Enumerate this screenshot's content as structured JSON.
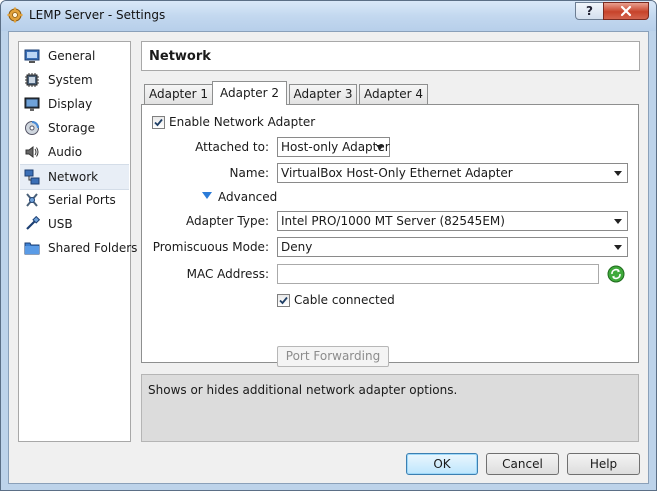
{
  "window": {
    "title": "LEMP Server - Settings",
    "help_label": "?"
  },
  "sidebar": {
    "items": [
      {
        "label": "General",
        "icon": "general-icon"
      },
      {
        "label": "System",
        "icon": "system-icon"
      },
      {
        "label": "Display",
        "icon": "display-icon"
      },
      {
        "label": "Storage",
        "icon": "storage-icon"
      },
      {
        "label": "Audio",
        "icon": "audio-icon"
      },
      {
        "label": "Network",
        "icon": "network-icon",
        "selected": true
      },
      {
        "label": "Serial Ports",
        "icon": "serial-ports-icon"
      },
      {
        "label": "USB",
        "icon": "usb-icon"
      },
      {
        "label": "Shared Folders",
        "icon": "shared-folders-icon"
      }
    ]
  },
  "header": {
    "title": "Network"
  },
  "tabs": [
    {
      "label": "Adapter 1"
    },
    {
      "label": "Adapter 2",
      "active": true
    },
    {
      "label": "Adapter 3"
    },
    {
      "label": "Adapter 4"
    }
  ],
  "adapter": {
    "enable_label": "Enable Network Adapter",
    "enable_checked": true,
    "attached_label": "Attached to:",
    "attached_value": "Host-only Adapter",
    "name_label": "Name:",
    "name_value": "VirtualBox Host-Only Ethernet Adapter",
    "advanced_label": "Advanced",
    "adapter_type_label": "Adapter Type:",
    "adapter_type_value": "Intel PRO/1000 MT Server (82545EM)",
    "promiscuous_label": "Promiscuous Mode:",
    "promiscuous_value": "Deny",
    "mac_label": "MAC Address:",
    "mac_value": "",
    "cable_label": "Cable connected",
    "cable_checked": true,
    "port_forwarding_label": "Port Forwarding"
  },
  "description": {
    "text": "Shows or hides additional network adapter options."
  },
  "buttons": {
    "ok": "OK",
    "cancel": "Cancel",
    "help": "Help"
  },
  "colors": {
    "accent": "#3c7fb1",
    "selection": "#e8eef6",
    "close": "#c7432b"
  }
}
